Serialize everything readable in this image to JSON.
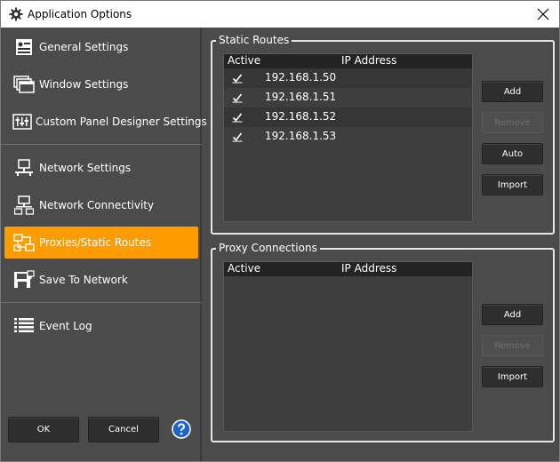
{
  "window": {
    "title": "Application Options",
    "icon": "gear-icon",
    "close_icon": "close-icon"
  },
  "sidebar": {
    "items": [
      {
        "label": "General Settings",
        "icon": "general-settings-icon",
        "active": false
      },
      {
        "label": "Window Settings",
        "icon": "window-settings-icon",
        "active": false
      },
      {
        "label": "Custom Panel Designer Settings",
        "icon": "panel-designer-icon",
        "active": false
      },
      {
        "label": "Network Settings",
        "icon": "network-icon",
        "active": false
      },
      {
        "label": "Network Connectivity",
        "icon": "network-connectivity-icon",
        "active": false
      },
      {
        "label": "Proxies/Static Routes",
        "icon": "proxies-icon",
        "active": true
      },
      {
        "label": "Save To Network",
        "icon": "save-to-network-icon",
        "active": false
      },
      {
        "label": "Event Log",
        "icon": "event-log-icon",
        "active": false
      }
    ],
    "ok_label": "OK",
    "cancel_label": "Cancel",
    "help_icon": "help-icon"
  },
  "static_routes": {
    "title": "Static Routes",
    "columns": [
      "Active",
      "IP Address"
    ],
    "rows": [
      {
        "active": true,
        "ip": "192.168.1.50"
      },
      {
        "active": true,
        "ip": "192.168.1.51"
      },
      {
        "active": true,
        "ip": "192.168.1.52"
      },
      {
        "active": true,
        "ip": "192.168.1.53"
      }
    ],
    "buttons": {
      "add": "Add",
      "remove": "Remove",
      "auto": "Auto",
      "import": "Import"
    }
  },
  "proxy_connections": {
    "title": "Proxy Connections",
    "columns": [
      "Active",
      "IP Address"
    ],
    "rows": [],
    "buttons": {
      "add": "Add",
      "remove": "Remove",
      "import": "Import"
    }
  },
  "colors": {
    "background": "#4b4b4b",
    "active_item": "#fc9c00",
    "list_header": "#232323",
    "help_blue": "#1e64c8"
  }
}
